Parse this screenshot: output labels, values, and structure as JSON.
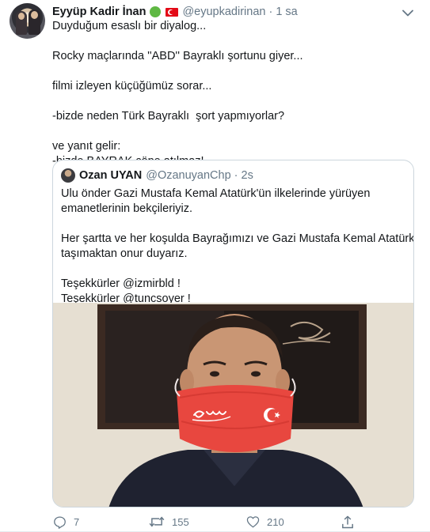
{
  "tweet": {
    "author_name": "Eyyüp Kadir İnan",
    "handle": "@eyupkadirinan",
    "separator": "·",
    "time": "1 sa",
    "lines": [
      "Duyduğum esaslı bir diyalog...",
      "",
      "Rocky maçlarında ''ABD'' Bayraklı şortunu giyer...",
      "",
      "filmi izleyen küçüğümüz sorar...",
      "",
      "-bizde neden Türk Bayraklı  şort yapmıyorlar?",
      "",
      "ve yanıt gelir:",
      "-bizde BAYRAK çöpe atılmaz!"
    ]
  },
  "quoted": {
    "author_name": "Ozan UYAN",
    "handle": "@OzanuyanChp",
    "separator": "·",
    "time": "2s",
    "lines": [
      "Ulu önder Gazi Mustafa Kemal Atatürk'ün ilkelerinde yürüyen",
      "emanetlerinin bekçileriyiz.",
      "",
      "Her şartta ve her koşulda Bayrağımızı ve Gazi Mustafa Kemal Atatürk'ü",
      "taşımaktan onur duyarız.",
      "",
      "Teşekkürler @izmirbld !",
      "Teşekkürler @tuncsoyer !"
    ]
  },
  "actions": {
    "reply_count": "7",
    "retweet_count": "155",
    "like_count": "210"
  },
  "colors": {
    "accent": "#1da1f2",
    "muted": "#657786",
    "border": "#ccd6dd",
    "mask_red": "#e8473f"
  },
  "icons": [
    "more-icon",
    "reply-icon",
    "retweet-icon",
    "like-icon",
    "share-icon"
  ]
}
